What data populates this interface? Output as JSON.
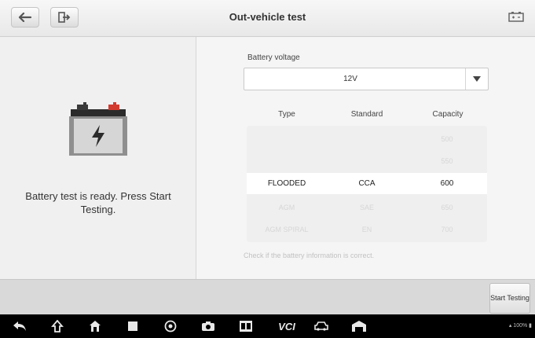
{
  "header": {
    "title": "Out-vehicle test",
    "back_icon": "back-arrow-icon",
    "exit_icon": "exit-icon",
    "battery_icon": "battery-status-icon"
  },
  "left_panel": {
    "icon": "battery-icon",
    "message": "Battery test is ready. Press Start Testing."
  },
  "form": {
    "voltage_label": "Battery voltage",
    "voltage_value": "12V"
  },
  "table": {
    "columns": [
      "Type",
      "Standard",
      "Capacity"
    ],
    "rows": [
      {
        "type": "",
        "standard": "",
        "capacity": "500",
        "state": "faded"
      },
      {
        "type": "",
        "standard": "",
        "capacity": "550",
        "state": "faded"
      },
      {
        "type": "FLOODED",
        "standard": "CCA",
        "capacity": "600",
        "state": "selected"
      },
      {
        "type": "AGM",
        "standard": "SAE",
        "capacity": "650",
        "state": "faded"
      },
      {
        "type": "AGM SPIRAL",
        "standard": "EN",
        "capacity": "700",
        "state": "faded"
      }
    ]
  },
  "hint": "Check if the battery information is correct.",
  "actions": {
    "start_label": "Start Testing"
  },
  "navbar": {
    "vci_label": "VCI",
    "status_text": "100%"
  },
  "colors": {
    "accent_red": "#e0322d"
  }
}
